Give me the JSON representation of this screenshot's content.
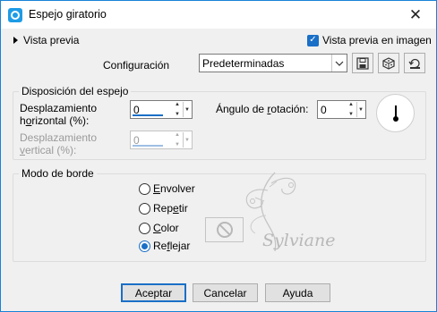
{
  "window": {
    "title": "Espejo giratorio",
    "close_glyph": "✕"
  },
  "preview": {
    "toggle_label": "Vista previa",
    "live_preview_label": "Vista previa en imagen",
    "live_preview_checked": true
  },
  "config": {
    "label": "Configuración",
    "preset_value": "Predeterminadas"
  },
  "mirror": {
    "legend": "Disposición del espejo",
    "h_offset": {
      "label_line1": "Desplazamiento",
      "label_line2_pre": "h",
      "label_line2_accel": "o",
      "label_line2_post": "rizontal (%):",
      "value": "0",
      "enabled": true
    },
    "v_offset": {
      "label_line1": "Desplazamiento",
      "label_line2_pre": "",
      "label_line2_accel": "v",
      "label_line2_post": "ertical (%):",
      "value": "0",
      "enabled": false
    },
    "rotation": {
      "label_pre": "Ángulo de ",
      "label_accel": "r",
      "label_post": "otación:",
      "value": "0"
    }
  },
  "edge": {
    "legend": "Modo de borde",
    "options": [
      {
        "accel": "E",
        "rest": "nvolver",
        "checked": false
      },
      {
        "pre": "Rep",
        "accel": "e",
        "rest": "tir",
        "checked": false
      },
      {
        "accel": "C",
        "rest": "olor",
        "checked": false
      },
      {
        "pre": "Re",
        "accel": "f",
        "rest": "lejar",
        "checked": true
      }
    ]
  },
  "watermark_text": "Sylviane",
  "buttons": {
    "ok": "Aceptar",
    "cancel": "Cancelar",
    "help": "Ayuda"
  },
  "colors": {
    "accent": "#1a6fc7",
    "window_border": "#1883d7",
    "dialog_bg": "#f0f0f0"
  },
  "icons": {
    "save": "save-icon",
    "randomize": "dice-icon",
    "reset": "reset-icon"
  }
}
